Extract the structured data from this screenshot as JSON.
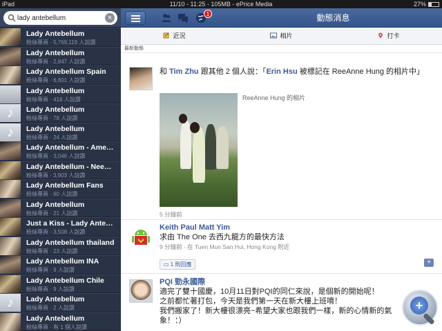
{
  "status_bar": {
    "device": "iPad",
    "center": "11/10 - 11:25 - 105MB - ePrice Media",
    "battery": "27%"
  },
  "search": {
    "query": "lady antebellum"
  },
  "results": [
    {
      "title": "Lady Antebellum",
      "sub": "粉絲專頁 · 5,769,119 人說讚",
      "thumb": "photo"
    },
    {
      "title": "Lady Antebellum",
      "sub": "粉絲專頁 · 2,847 人說讚",
      "thumb": "photo2"
    },
    {
      "title": "Lady Antebellum Spain",
      "sub": "粉絲專頁 · 6,801 人說讚",
      "thumb": "photo3"
    },
    {
      "title": "Lady Antebellum",
      "sub": "粉絲專頁 · 418 人說讚",
      "thumb": "bag"
    },
    {
      "title": "Lady Antebellum",
      "sub": "粉絲專頁 · 78 人說讚",
      "thumb": "note"
    },
    {
      "title": "Lady Antebellum",
      "sub": "粉絲專頁 · 24 人說讚",
      "thumb": "note"
    },
    {
      "title": "Lady Antebellum - Ame…",
      "sub": "粉絲專頁 · 3,046 人說讚",
      "thumb": "photo2"
    },
    {
      "title": "Lady Antebellum - Nee…",
      "sub": "粉絲專頁 · 3,903 人說讚",
      "thumb": "photo"
    },
    {
      "title": "Lady Antebellum Fans",
      "sub": "粉絲專頁 · 60 人說讚",
      "thumb": "photo3"
    },
    {
      "title": "Lady Antebellum",
      "sub": "粉絲專頁 · 21 人說讚",
      "thumb": "photo2"
    },
    {
      "title": "Just a Kiss - Lady Ante…",
      "sub": "粉絲專頁 · 3,508 人說讚",
      "thumb": "photo"
    },
    {
      "title": "Lady Antebellum thailand",
      "sub": "粉絲專頁 · 23 人說讚",
      "thumb": "photo3"
    },
    {
      "title": "Lady Antebellum INA",
      "sub": "粉絲專頁 · 9 人說讚",
      "thumb": "photo2"
    },
    {
      "title": "Lady Antebellum Chile",
      "sub": "粉絲專頁 · 9 人說讚",
      "thumb": "photo"
    },
    {
      "title": "Lady Antebellum",
      "sub": "粉絲專頁 · 2 人說讚",
      "thumb": "note"
    },
    {
      "title": "Lady Antebellum",
      "sub": "粉絲專頁 · 有 1 個人說讚",
      "thumb": "photo3"
    }
  ],
  "navbar": {
    "title": "動態消息",
    "notification_count": "1"
  },
  "actions": [
    {
      "label": "近況",
      "icon": "pencil-icon"
    },
    {
      "label": "相片",
      "icon": "photo-icon"
    },
    {
      "label": "打卡",
      "icon": "pin-icon"
    }
  ],
  "section_label": "最新動態",
  "stories": [
    {
      "prefix": "和 ",
      "actor": "Tim Zhu",
      "middle": " 跟其他 2 個人說：「",
      "tagged": "Erin Hsu",
      "after": " 被標記在 ReeAnne Hung 的相片中」",
      "caption": "ReeAnne Hung 的相片",
      "time": "5 分鐘前"
    },
    {
      "name": "Keith Paul Matt Yim",
      "text": "求由 The One 去西九龍方的最快方法",
      "meta": "9 分鐘前 · 在 Tuen Mun San Hui, Hong Kong 附近",
      "comments": "1 則回應"
    },
    {
      "name": "PQI 勁永國際",
      "line1": "適完了雙十國慶，10月11日對PQI的同仁來說，是個新的開始呢！",
      "line2": "之前都忙著打包，今天是我們第一天在新大樓上班唷！",
      "line3": "我們搬家了！新大樓很漂亮~希望大家也跟我們一樣，新的心情新的氣象！：）"
    }
  ]
}
